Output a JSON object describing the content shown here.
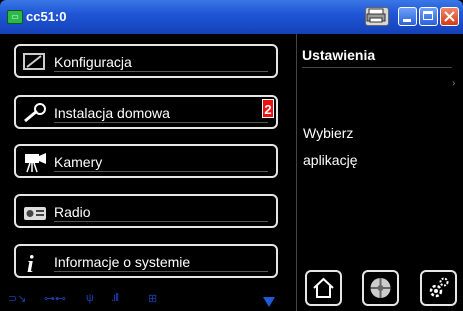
{
  "window": {
    "title": "cc51:0"
  },
  "menu": {
    "items": [
      {
        "label": "Konfiguracja"
      },
      {
        "label": "Instalacja domowa",
        "badge": "2"
      },
      {
        "label": "Kamery"
      },
      {
        "label": "Radio"
      },
      {
        "label": "Informacje o systemie"
      }
    ]
  },
  "panel": {
    "title": "Ustawienia",
    "message_line1": "Wybierz",
    "message_line2": "aplikację"
  },
  "colors": {
    "titlebar": "#1f56d6",
    "badge": "#e11111",
    "status_icons": "#1a3fb5"
  }
}
